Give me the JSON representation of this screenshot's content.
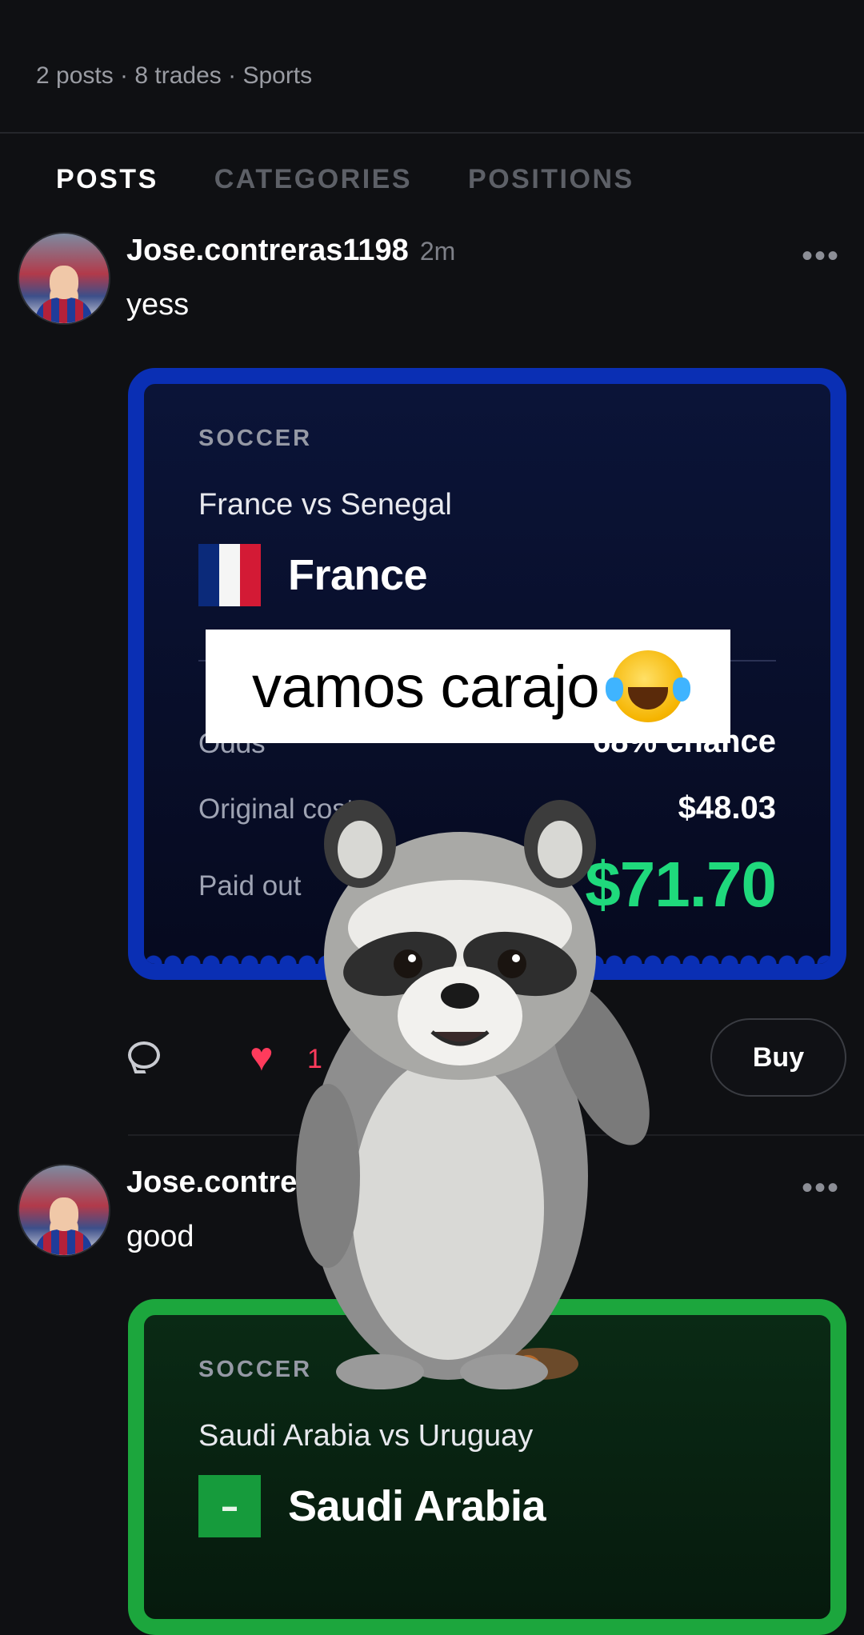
{
  "profile": {
    "stats": "2 posts · 8 trades · Sports"
  },
  "tabs": [
    {
      "label": "POSTS",
      "active": true
    },
    {
      "label": "CATEGORIES",
      "active": false
    },
    {
      "label": "POSITIONS",
      "active": false
    }
  ],
  "posts": [
    {
      "username": "Jose.contreras1198",
      "time": "2m",
      "text": "yess",
      "card": {
        "color": "#0a2fb4",
        "sport": "SOCCER",
        "match": "France vs Senegal",
        "pick": "France",
        "flag": "france-flag",
        "odds_label": "Odds",
        "odds_value": "68% chance",
        "cost_label": "Original cost",
        "cost_value": "$48.03",
        "paid_label": "Paid out",
        "paid_value": "$71.70"
      },
      "likes": "1",
      "buy_label": "Buy"
    },
    {
      "username": "Jose.contre",
      "text": "good",
      "card": {
        "color": "#1ca63d",
        "sport": "SOCCER",
        "match": "Saudi Arabia vs Uruguay",
        "pick": "Saudi Arabia",
        "flag": "saudi-arabia-flag"
      }
    }
  ],
  "overlay": {
    "caption": "vamos carajo",
    "emoji": "tears-of-joy-emoji"
  },
  "more_label": "•••"
}
